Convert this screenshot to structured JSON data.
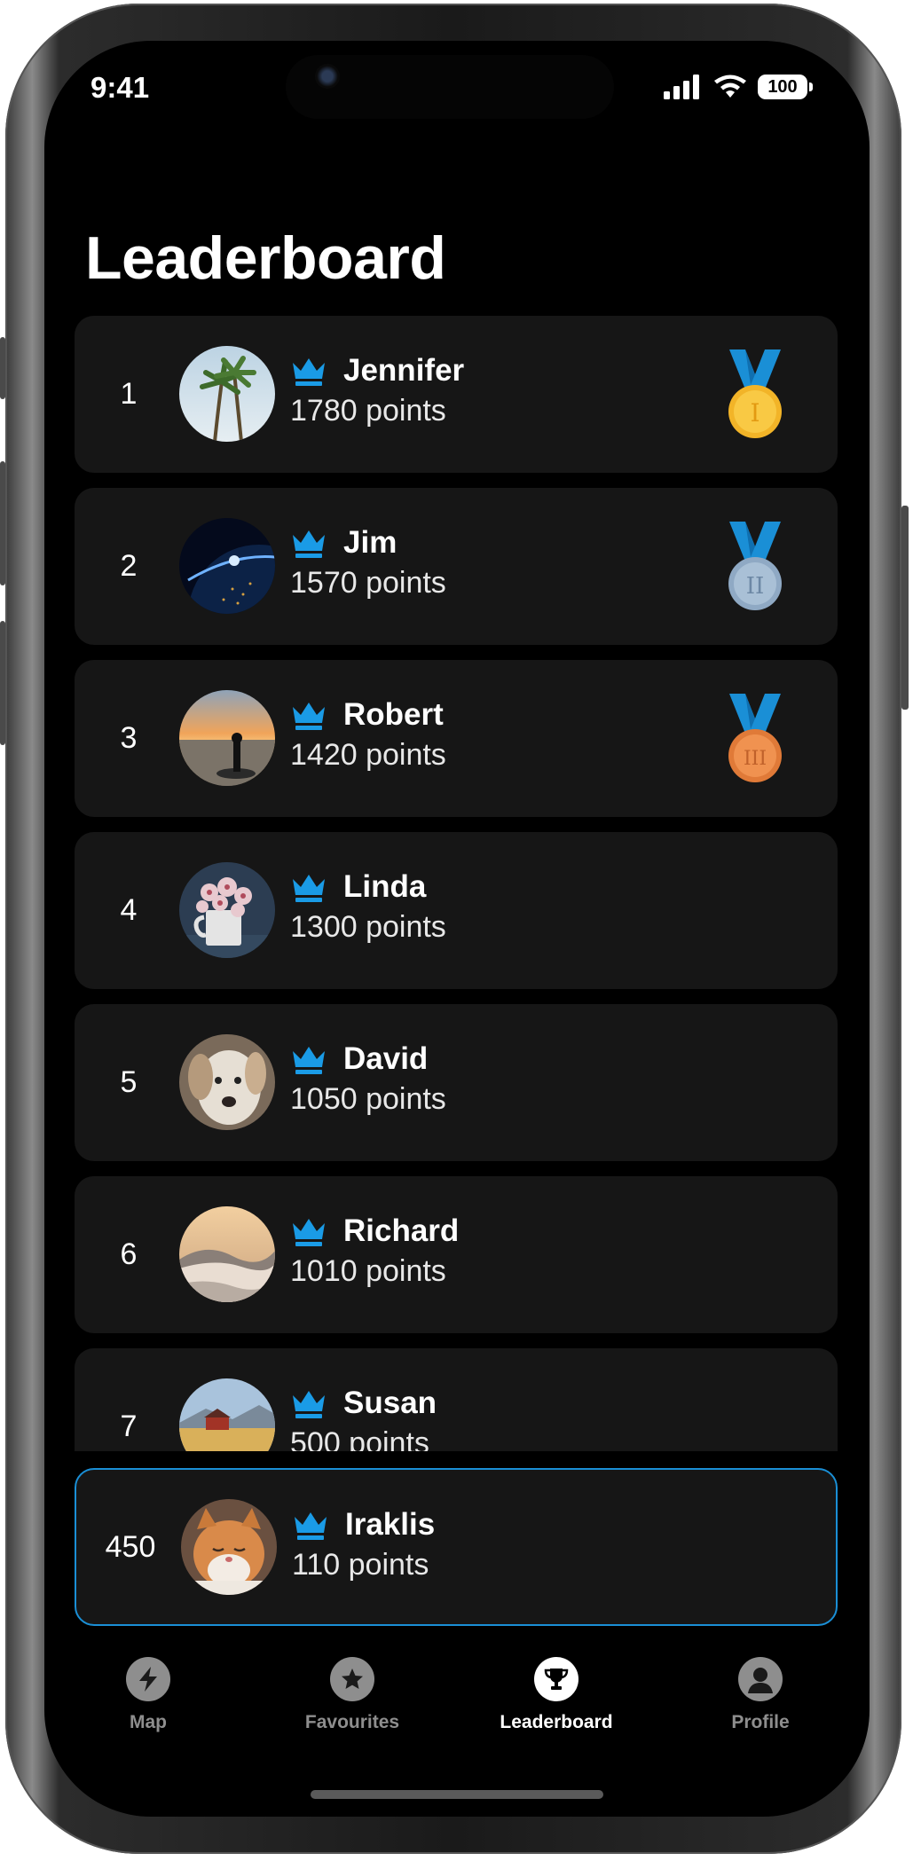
{
  "status_bar": {
    "time": "9:41",
    "battery": "100"
  },
  "page_title": "Leaderboard",
  "accent_color": "#1a9be6",
  "leaderboard": [
    {
      "rank": "1",
      "name": "Jennifer",
      "points": "1780 points",
      "avatar": "palm-trees-photo",
      "medal": "gold"
    },
    {
      "rank": "2",
      "name": "Jim",
      "points": "1570 points",
      "avatar": "earth-from-space-photo",
      "medal": "silver"
    },
    {
      "rank": "3",
      "name": "Robert",
      "points": "1420 points",
      "avatar": "sunset-silhouette-photo",
      "medal": "bronze"
    },
    {
      "rank": "4",
      "name": "Linda",
      "points": "1300 points",
      "avatar": "flower-mug-photo"
    },
    {
      "rank": "5",
      "name": "David",
      "points": "1050 points",
      "avatar": "dog-photo"
    },
    {
      "rank": "6",
      "name": "Richard",
      "points": "1010 points",
      "avatar": "foggy-mountains-photo"
    },
    {
      "rank": "7",
      "name": "Susan",
      "points": "500 points",
      "avatar": "red-house-lake-photo"
    }
  ],
  "current_user": {
    "rank": "450",
    "name": "Iraklis",
    "points": "110 points",
    "avatar": "cat-photo"
  },
  "tabs": [
    {
      "label": "Map",
      "icon": "bolt-icon",
      "active": false
    },
    {
      "label": "Favourites",
      "icon": "star-icon",
      "active": false
    },
    {
      "label": "Leaderboard",
      "icon": "trophy-icon",
      "active": true
    },
    {
      "label": "Profile",
      "icon": "person-icon",
      "active": false
    }
  ]
}
